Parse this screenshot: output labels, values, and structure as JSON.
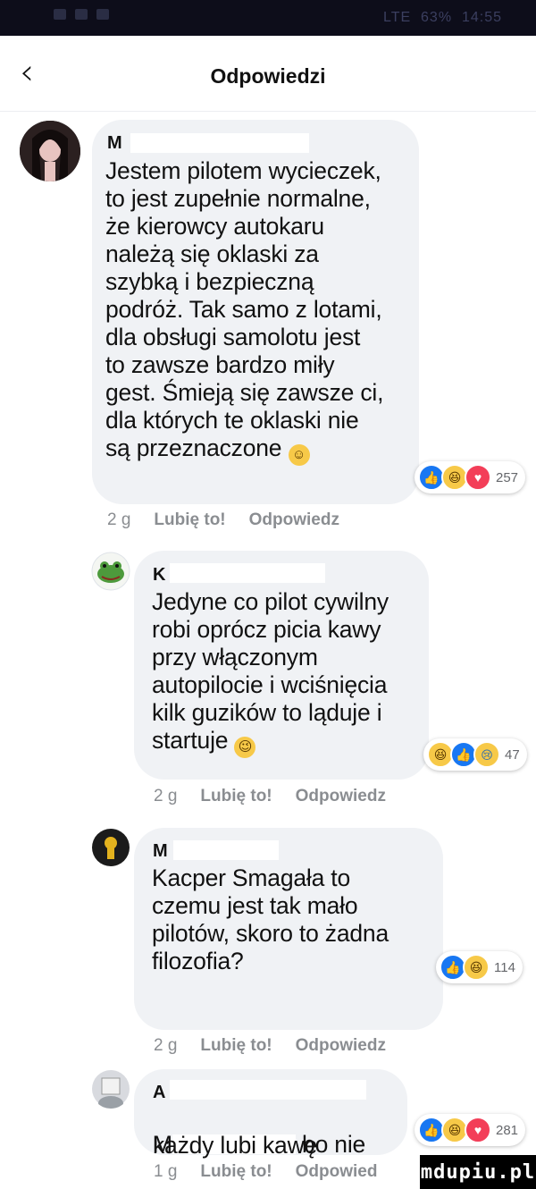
{
  "status_bar": {
    "time": "14:55",
    "battery": "63%",
    "network": "LTE"
  },
  "header": {
    "title": "Odpowiedzi",
    "back_icon": "chevron-left-icon"
  },
  "comments": [
    {
      "author": "M",
      "text": "Jestem pilotem wycieczek,\nto jest zupełnie normalne,\nże kierowcy autokaru\nnależą się oklaski za\nszybką i bezpieczną\npodróż. Tak samo z lotami,\ndla obsługi samolotu jest\nto zawsze bardzo miły\ngest. Śmieją się zawsze ci,\ndla których te oklaski nie\nsą przeznaczone",
      "emoji": "☺",
      "reactions": [
        "like",
        "haha",
        "love"
      ],
      "reaction_count": "257",
      "time": "2 g",
      "like_label": "Lubię to!",
      "reply_label": "Odpowiedz"
    },
    {
      "author": "K",
      "text": "Jedyne co pilot cywilny\nrobi oprócz picia kawy\nprzy włączonym\nautopilocie i wciśnięcia\nkilk guzików to ląduje i\nstartuje",
      "emoji": "😉",
      "reactions": [
        "haha",
        "like",
        "sad"
      ],
      "reaction_count": "47",
      "time": "2 g",
      "like_label": "Lubię to!",
      "reply_label": "Odpowiedz"
    },
    {
      "author": "M",
      "text": "Kacper Smagała to\nczemu jest tak mało\npilotów, skoro to żadna\nfilozofia?",
      "reactions": [
        "like",
        "haha"
      ],
      "reaction_count": "114",
      "time": "2 g",
      "like_label": "Lubię to!",
      "reply_label": "Odpowiedz"
    },
    {
      "author": "A",
      "line2_prefix": "M",
      "line2_suffix": "bo nie",
      "text": "każdy lubi kawę",
      "reactions": [
        "like",
        "haha",
        "love"
      ],
      "reaction_count": "281",
      "time": "1 g",
      "like_label": "Lubię to!",
      "reply_label": "Odpowied"
    }
  ],
  "watermark": "mdupiu.pl"
}
